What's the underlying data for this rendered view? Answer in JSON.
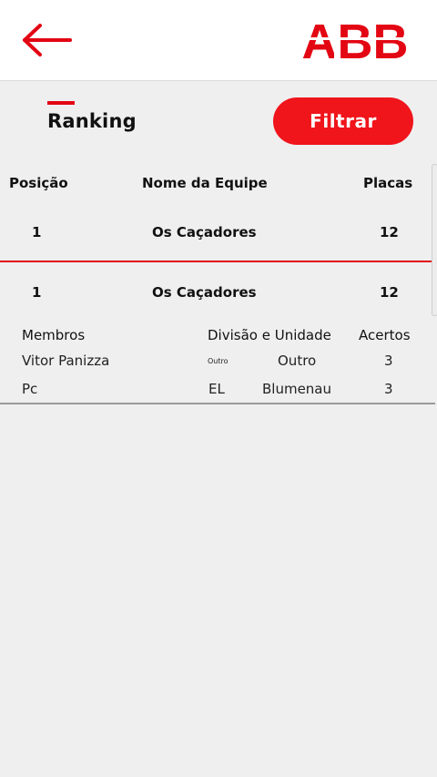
{
  "header": {
    "logo_text": "ABB",
    "brand_color": "#e30613"
  },
  "ranking": {
    "title": "Ranking",
    "filter_label": "Filtrar"
  },
  "table": {
    "columns": [
      "Posição",
      "Nome da Equipe",
      "Placas"
    ],
    "rows": [
      {
        "position": "1",
        "team": "Os Caçadores",
        "plates": "12"
      },
      {
        "position": "1",
        "team": "Os Caçadores",
        "plates": "12"
      }
    ]
  },
  "members": {
    "columns": [
      "Membros",
      "Divisão e Unidade",
      "Acertos"
    ],
    "rows": [
      {
        "name": "Vitor Panizza",
        "division": "Outro",
        "unit": "Outro",
        "hits": "3"
      },
      {
        "name": "Pc",
        "division": "EL",
        "unit": "Blumenau",
        "hits": "3"
      }
    ]
  }
}
